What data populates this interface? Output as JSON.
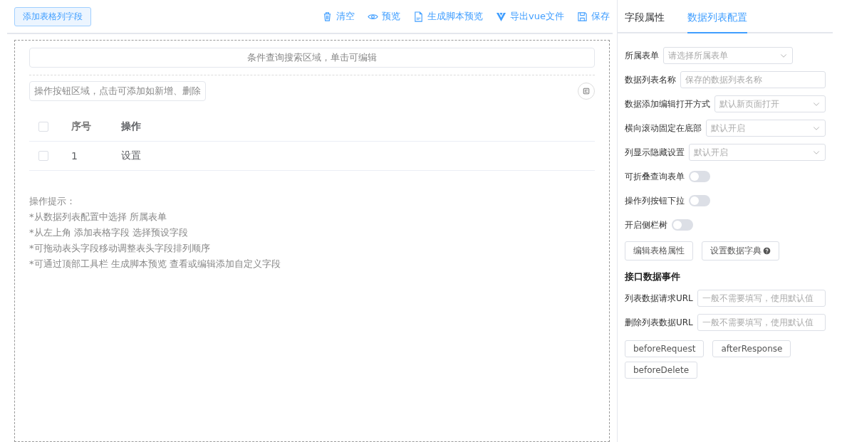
{
  "toolbar": {
    "add_button": "添加表格列字段",
    "actions": [
      {
        "kind": "clear",
        "label": "清空"
      },
      {
        "kind": "preview",
        "label": "预览"
      },
      {
        "kind": "script",
        "label": "生成脚本预览"
      },
      {
        "kind": "export",
        "label": "导出vue文件"
      },
      {
        "kind": "save",
        "label": "保存"
      }
    ]
  },
  "canvas": {
    "search_area": "条件查询搜索区域，单击可编辑",
    "action_area": "操作按钮区域，点击可添加如新增、删除",
    "table": {
      "header_checked": false,
      "columns": [
        "序号",
        "操作"
      ],
      "rows": [
        {
          "checked": false,
          "cells": [
            "1",
            "设置"
          ]
        }
      ]
    },
    "tips": [
      "操作提示：",
      "*从数据列表配置中选择 所属表单",
      "*从左上角 添加表格字段 选择预设字段",
      "*可拖动表头字段移动调整表头字段排列顺序",
      "*可通过顶部工具栏 生成脚本预览 查看或编辑添加自定义字段"
    ]
  },
  "panel": {
    "tabs": [
      {
        "label": "字段属性",
        "selected": false
      },
      {
        "label": "数据列表配置",
        "selected": true
      }
    ],
    "fields": [
      {
        "kind": "select",
        "label": "所属表单",
        "placeholder": "请选择所属表单"
      },
      {
        "kind": "input",
        "label": "数据列表名称",
        "placeholder": "保存的数据列表名称"
      },
      {
        "kind": "select",
        "label": "数据添加编辑打开方式",
        "placeholder": "默认新页面打开"
      },
      {
        "kind": "select",
        "label": "横向滚动固定在底部",
        "placeholder": "默认开启"
      },
      {
        "kind": "select",
        "label": "列显示隐藏设置",
        "placeholder": "默认开启"
      },
      {
        "kind": "switch",
        "label": "可折叠查询表单",
        "on": false
      },
      {
        "kind": "switch",
        "label": "操作列按钮下拉",
        "on": false
      },
      {
        "kind": "switch",
        "label": "开启侧栏树",
        "on": false
      }
    ],
    "buttons": [
      {
        "label": "编辑表格属性",
        "help": false
      },
      {
        "label": "设置数据字典",
        "help": true
      }
    ],
    "section_title": "接口数据事件",
    "url_fields": [
      {
        "label": "列表数据请求URL",
        "placeholder": "一般不需要填写，使用默认值"
      },
      {
        "label": "删除列表数据URL",
        "placeholder": "一般不需要填写，使用默认值"
      }
    ],
    "event_buttons": [
      "beforeRequest",
      "afterResponse",
      "beforeDelete"
    ]
  }
}
